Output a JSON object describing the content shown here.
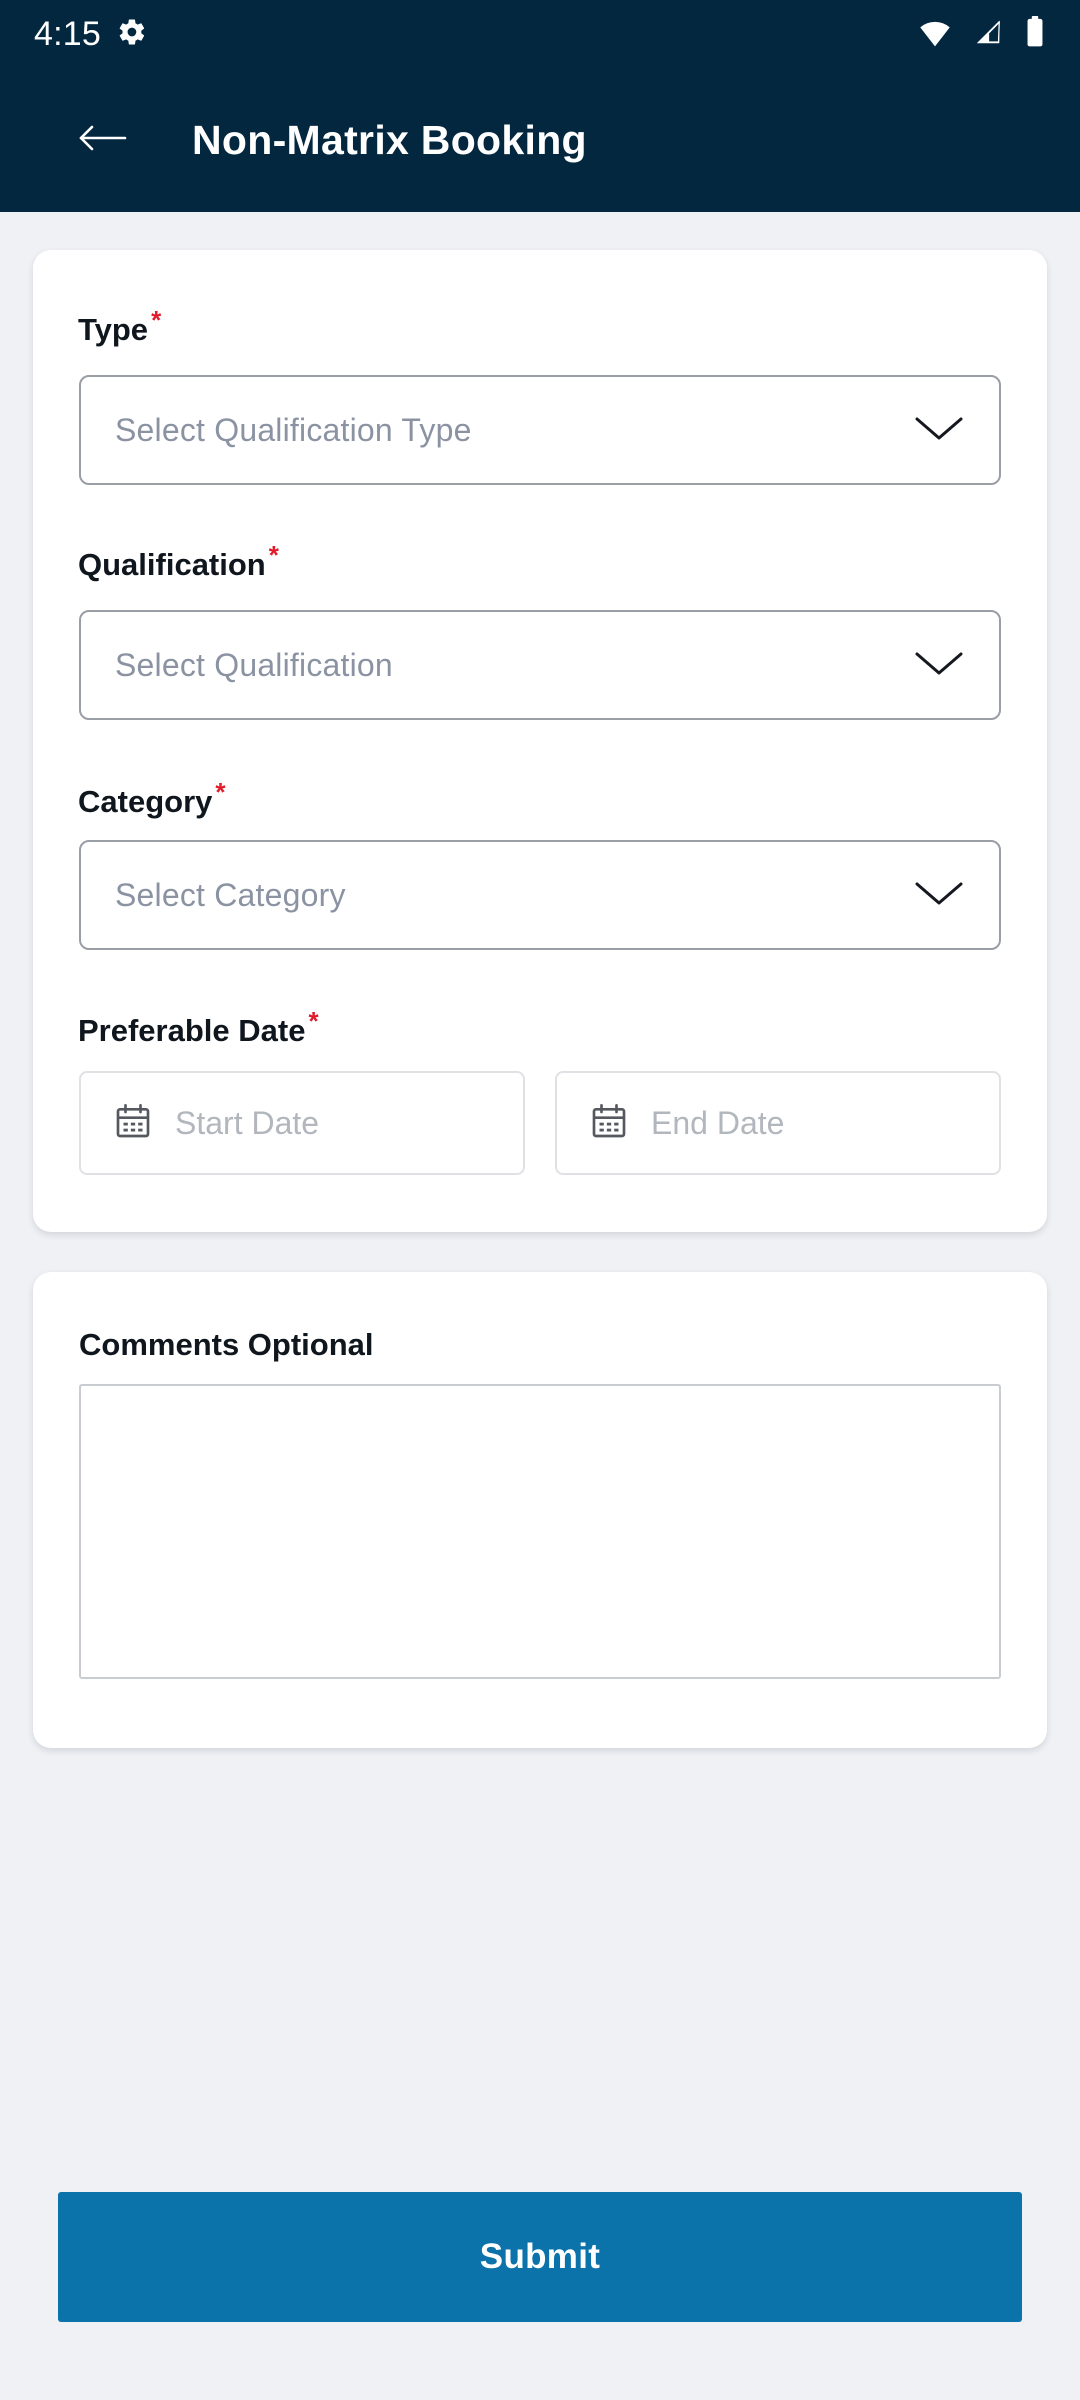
{
  "statusbar": {
    "time": "4:15",
    "icons": [
      "gear-icon",
      "wifi-icon",
      "cellular-signal-icon",
      "battery-icon"
    ]
  },
  "appbar": {
    "back_icon": "arrow-left-icon",
    "title": "Non-Matrix Booking"
  },
  "form": {
    "required_marker": "*",
    "fields": [
      {
        "label": "Type",
        "placeholder": "Select Qualification Type",
        "required": true,
        "control": "dropdown"
      },
      {
        "label": "Qualification",
        "placeholder": "Select Qualification",
        "required": true,
        "control": "dropdown"
      },
      {
        "label": "Category",
        "placeholder": "Select Category",
        "required": true,
        "control": "dropdown"
      }
    ],
    "date_group": {
      "label": "Preferable Date",
      "required": true,
      "start": {
        "placeholder": "Start Date",
        "value": ""
      },
      "end": {
        "placeholder": "End Date",
        "value": ""
      }
    }
  },
  "comments": {
    "label": "Comments Optional",
    "value": "",
    "placeholder": ""
  },
  "submit": {
    "label": "Submit"
  },
  "colors": {
    "header_navy": "#042740",
    "submit_blue": "#0b72aa",
    "page_bg": "#eff1f5",
    "card_bg": "#ffffff",
    "required_red": "#e01b2b",
    "placeholder_gray": "#8b93a3",
    "select_border": "#9a9ea5",
    "date_border": "#dfe1e5"
  }
}
